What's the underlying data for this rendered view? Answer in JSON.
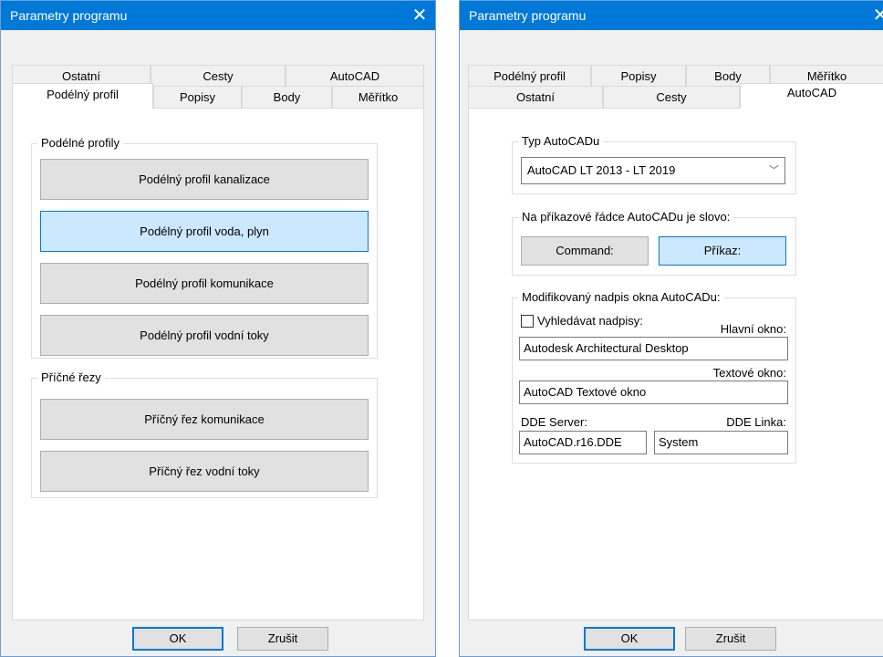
{
  "dialog1": {
    "title": "Parametry programu",
    "tabs_back": [
      "Ostatní",
      "Cesty",
      "AutoCAD"
    ],
    "tabs_front": [
      "Podélný profil",
      "Popisy",
      "Body",
      "Měřítko"
    ],
    "group1": {
      "legend": "Podélné profily",
      "buttons": [
        "Podélný profil kanalizace",
        "Podélný profil voda, plyn",
        "Podélný profil komunikace",
        "Podélný profil vodní toky"
      ]
    },
    "group2": {
      "legend": "Příčné řezy",
      "buttons": [
        "Příčný řez komunikace",
        "Příčný řez vodní toky"
      ]
    },
    "ok": "OK",
    "cancel": "Zrušit"
  },
  "dialog2": {
    "title": "Parametry programu",
    "tabs_back": [
      "Podélný profil",
      "Popisy",
      "Body",
      "Měřítko"
    ],
    "tabs_front": [
      "Ostatní",
      "Cesty",
      "AutoCAD"
    ],
    "type_group": {
      "legend": "Typ AutoCADu",
      "selected": "AutoCAD LT 2013 - LT 2019"
    },
    "cmd_group": {
      "legend": "Na příkazové řádce AutoCADu je slovo:",
      "command": "Command:",
      "prikaz": "Příkaz:"
    },
    "title_group": {
      "legend": "Modifikovaný nadpis okna AutoCADu:",
      "search_label": "Vyhledávat nadpisy:",
      "main_label": "Hlavní okno:",
      "main_value": "Autodesk Architectural Desktop",
      "text_label": "Textové okno:",
      "text_value": "AutoCAD Textové okno",
      "dde_server_label": "DDE Server:",
      "dde_link_label": "DDE Linka:",
      "dde_server_value": "AutoCAD.r16.DDE",
      "dde_link_value": "System"
    },
    "ok": "OK",
    "cancel": "Zrušit"
  }
}
